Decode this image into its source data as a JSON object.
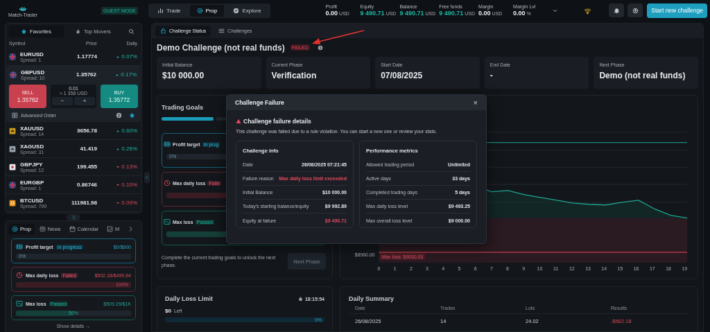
{
  "topbar": {
    "logo_text": "Match-Trader",
    "mode_badge": "GUEST MODE",
    "nav": [
      {
        "label": "Trade",
        "selected": false
      },
      {
        "label": "Prop",
        "selected": true
      },
      {
        "label": "Explore",
        "selected": false
      }
    ],
    "stats": [
      {
        "label": "Profit",
        "value": "0.00",
        "unit": "USD",
        "positive": false
      },
      {
        "label": "Equity",
        "value": "9 490.71",
        "unit": "USD",
        "positive": true
      },
      {
        "label": "Balance",
        "value": "9 490.71",
        "unit": "USD",
        "positive": true
      },
      {
        "label": "Free funds",
        "value": "9 490.71",
        "unit": "USD",
        "positive": true
      },
      {
        "label": "Margin",
        "value": "0.00",
        "unit": "USD",
        "positive": false
      },
      {
        "label": "Margin Lvl",
        "value": "0.00",
        "unit": "%",
        "positive": false
      }
    ],
    "cta": "Start new challenge"
  },
  "watchlist": {
    "tabs": [
      {
        "label": "Favorites",
        "selected": true
      },
      {
        "label": "Top Movers",
        "selected": false
      }
    ],
    "columns": [
      "Symbol",
      "Price",
      "Daily"
    ],
    "rows": [
      {
        "symbol": "EURUSD",
        "spread": "Spread: 1",
        "price": "1.17774",
        "change": "0.07%",
        "rising": true,
        "expanded": false
      },
      {
        "symbol": "GBPUSD",
        "spread": "Spread: 10",
        "price": "1.35762",
        "change": "0.17%",
        "rising": true,
        "expanded": true,
        "order": {
          "sell_label": "SELL",
          "sell_price": "1.35762",
          "lot": "0.01",
          "lot_value": "≈ 1 358 USD",
          "minus": "−",
          "plus": "+",
          "buy_label": "BUY",
          "buy_price": "1.35772",
          "advanced": "Advanced Order"
        }
      },
      {
        "symbol": "XAUUSD",
        "spread": "Spread: 14",
        "price": "3656.78",
        "change": "0.60%",
        "rising": true,
        "expanded": false
      },
      {
        "symbol": "XAGUSD",
        "spread": "Spread: 31",
        "price": "41.419",
        "change": "0.26%",
        "rising": true,
        "expanded": false
      },
      {
        "symbol": "GBPJPY",
        "spread": "Spread: 12",
        "price": "199.455",
        "change": "0.13%",
        "rising": false,
        "expanded": false
      },
      {
        "symbol": "EURGBP",
        "spread": "Spread: 1",
        "price": "0.86746",
        "change": "0.10%",
        "rising": false,
        "expanded": false
      },
      {
        "symbol": "BTCUSD",
        "spread": "Spread: 799",
        "price": "111981.98",
        "change": "0.09%",
        "rising": false,
        "expanded": false
      }
    ]
  },
  "prop_panel": {
    "tabs": [
      {
        "label": "Prop",
        "selected": true
      },
      {
        "label": "News",
        "selected": false
      },
      {
        "label": "Calendar",
        "selected": false
      },
      {
        "label": "M",
        "selected": false
      }
    ],
    "goals": [
      {
        "name": "Profit target",
        "status": "In progress",
        "kind": "in_progress",
        "amount": "$0/$600",
        "percent": "0%",
        "level": 0
      },
      {
        "name": "Max daily loss",
        "status": "Failed",
        "kind": "failed",
        "amount": "$502.18/$499.64",
        "percent": "100%",
        "level": 1
      },
      {
        "name": "Max loss",
        "status": "Passed",
        "kind": "passed",
        "amount": "$509.29/$1K",
        "percent": "50%",
        "level": 0.5
      }
    ],
    "show_details": "Show details →"
  },
  "main_tabs": [
    {
      "label": "Challenge Status",
      "selected": true
    },
    {
      "label": "Challenges",
      "selected": false
    }
  ],
  "challenge": {
    "title": "Demo Challenge (not real funds)",
    "status_badge": "FAILED"
  },
  "summary_cards": [
    {
      "label": "Initial Balance",
      "value": "$10 000.00"
    },
    {
      "label": "Current Phase",
      "value": "Verification"
    },
    {
      "label": "Start Date",
      "value": "07/08/2025"
    },
    {
      "label": "End Date",
      "value": "-"
    },
    {
      "label": "Next Phase",
      "value": "Demo (not real funds)"
    }
  ],
  "trading_goals": {
    "title": "Trading Goals",
    "segments": [
      {
        "filled": true
      },
      {
        "filled": false
      }
    ],
    "goals": [
      {
        "name": "Profit target",
        "status": "In prog",
        "kind": "in_progress",
        "percent": "0%",
        "level": 0
      },
      {
        "name": "Max daily loss",
        "status": "Faile",
        "kind": "failed",
        "level": 1
      },
      {
        "name": "Max loss",
        "status": "Passed",
        "kind": "passed",
        "level": 0.5
      }
    ],
    "note": "Complete the current trading goals to unlock the next phase.",
    "next_button": {
      "label": "Next Phase",
      "disabled": true
    }
  },
  "chart": {
    "y_label": "$8960.00",
    "max_loss_label": "Max loss: $9000.00",
    "x_ticks": [
      "0",
      "1",
      "2",
      "3",
      "4",
      "5",
      "6",
      "7",
      "8",
      "9",
      "10",
      "11",
      "12",
      "13",
      "14",
      "15",
      "16",
      "17",
      "18",
      "19"
    ]
  },
  "daily_loss": {
    "title": "Daily Loss Limit",
    "timer": "18:15:54",
    "amount": "$0",
    "amount_note": "Left",
    "percent": "0%",
    "level": 0
  },
  "daily_summary": {
    "title": "Daily Summary",
    "columns": [
      "Date",
      "Trades",
      "Lots",
      "Results"
    ],
    "rows": [
      {
        "date": "26/08/2025",
        "trades": "14",
        "lots": "24.02",
        "result": "-$502.18",
        "negative": true
      }
    ]
  },
  "modal": {
    "title": "Challenge Failure",
    "close": "×",
    "heading": "Challenge failure details",
    "message": "This challenge was failed due to a rule violation. You can start a new one or review your stats.",
    "panels": [
      {
        "title": "Challenge info",
        "rows": [
          {
            "label": "Date",
            "value": "26/08/2025 07:21:45",
            "alert": false
          },
          {
            "label": "Failure reason",
            "value": "Max daily loss limit exceeded",
            "alert": true
          },
          {
            "label": "Initial Balance",
            "value": "$10 000.00",
            "alert": false
          },
          {
            "label": "Today's starting balance/equity",
            "value": "$9 992.89",
            "alert": false
          },
          {
            "label": "Equity at failure",
            "value": "$9 490.71",
            "alert": true
          }
        ]
      },
      {
        "title": "Performance metrics",
        "rows": [
          {
            "label": "Allowed trading period",
            "value": "Unlimited",
            "alert": false
          },
          {
            "label": "Active days",
            "value": "33 days",
            "alert": false
          },
          {
            "label": "Completed trading days",
            "value": "5 days",
            "alert": false
          },
          {
            "label": "Max daily loss level",
            "value": "$9 493.25",
            "alert": false
          },
          {
            "label": "Max overall loss level",
            "value": "$9 000.00",
            "alert": false
          }
        ]
      }
    ]
  }
}
